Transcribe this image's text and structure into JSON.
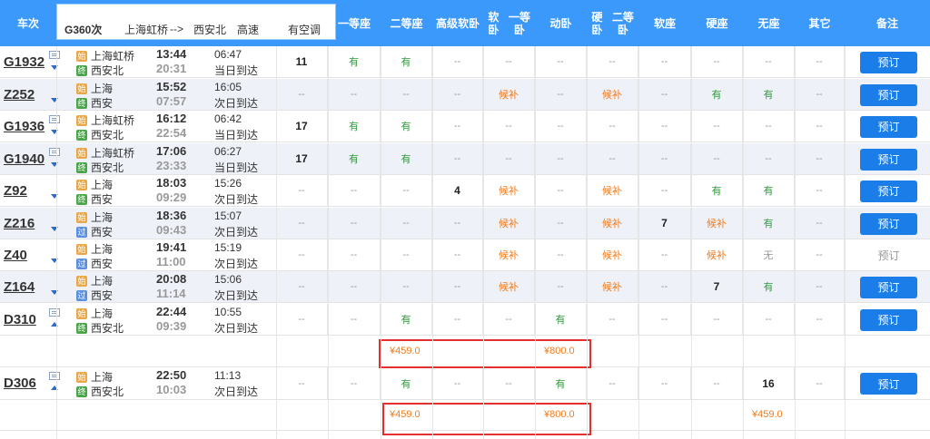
{
  "header": {
    "train_no": "车次",
    "route_train": "G360次",
    "route_from": "上海虹桥",
    "route_arrow": "-->",
    "route_to": "西安北",
    "route_type": "高速",
    "route_status": "有空调",
    "cols": [
      {
        "l1": "一等座",
        "l2": ""
      },
      {
        "l1": "二等座",
        "l2": ""
      },
      {
        "l1": "高级",
        "l2": "软卧"
      },
      {
        "l1": "软卧",
        "l2": "一等卧"
      },
      {
        "l1": "动卧",
        "l2": ""
      },
      {
        "l1": "硬卧",
        "l2": "二等卧"
      },
      {
        "l1": "软座",
        "l2": ""
      },
      {
        "l1": "硬座",
        "l2": ""
      },
      {
        "l1": "无座",
        "l2": ""
      },
      {
        "l1": "其它",
        "l2": ""
      },
      {
        "l1": "备注",
        "l2": ""
      }
    ]
  },
  "badges": {
    "start": "始",
    "end": "终",
    "pass": "过"
  },
  "trains": [
    {
      "no": "G1932",
      "from": "上海虹桥",
      "to": "西安北",
      "from_badge": "始",
      "to_badge": "终",
      "dep": "13:44",
      "arr": "20:31",
      "dur": "06:47",
      "day": "当日到达",
      "cells": [
        "11",
        "有",
        "有",
        "--",
        "--",
        "--",
        "--",
        "--",
        "--",
        "--",
        "--"
      ],
      "book": "预订",
      "book_enabled": true,
      "arrow": "down",
      "card": true
    },
    {
      "no": "Z252",
      "from": "上海",
      "to": "西安",
      "from_badge": "始",
      "to_badge": "终",
      "dep": "15:52",
      "arr": "07:57",
      "dur": "16:05",
      "day": "次日到达",
      "cells": [
        "--",
        "--",
        "--",
        "--",
        "候补",
        "--",
        "候补",
        "--",
        "有",
        "有",
        "--"
      ],
      "book": "预订",
      "book_enabled": true,
      "arrow": "down",
      "card": false
    },
    {
      "no": "G1936",
      "from": "上海虹桥",
      "to": "西安北",
      "from_badge": "始",
      "to_badge": "终",
      "dep": "16:12",
      "arr": "22:54",
      "dur": "06:42",
      "day": "当日到达",
      "cells": [
        "17",
        "有",
        "有",
        "--",
        "--",
        "--",
        "--",
        "--",
        "--",
        "--",
        "--"
      ],
      "book": "预订",
      "book_enabled": true,
      "arrow": "down",
      "card": true
    },
    {
      "no": "G1940",
      "from": "上海虹桥",
      "to": "西安北",
      "from_badge": "始",
      "to_badge": "终",
      "dep": "17:06",
      "arr": "23:33",
      "dur": "06:27",
      "day": "当日到达",
      "cells": [
        "17",
        "有",
        "有",
        "--",
        "--",
        "--",
        "--",
        "--",
        "--",
        "--",
        "--"
      ],
      "book": "预订",
      "book_enabled": true,
      "arrow": "down",
      "card": true
    },
    {
      "no": "Z92",
      "from": "上海",
      "to": "西安",
      "from_badge": "始",
      "to_badge": "终",
      "dep": "18:03",
      "arr": "09:29",
      "dur": "15:26",
      "day": "次日到达",
      "cells": [
        "--",
        "--",
        "--",
        "4",
        "候补",
        "--",
        "候补",
        "--",
        "有",
        "有",
        "--"
      ],
      "book": "预订",
      "book_enabled": true,
      "arrow": "down",
      "card": false
    },
    {
      "no": "Z216",
      "from": "上海",
      "to": "西安",
      "from_badge": "始",
      "to_badge": "过",
      "dep": "18:36",
      "arr": "09:43",
      "dur": "15:07",
      "day": "次日到达",
      "cells": [
        "--",
        "--",
        "--",
        "--",
        "候补",
        "--",
        "候补",
        "7",
        "候补",
        "有",
        "--"
      ],
      "book": "预订",
      "book_enabled": true,
      "arrow": "down",
      "card": false
    },
    {
      "no": "Z40",
      "from": "上海",
      "to": "西安",
      "from_badge": "始",
      "to_badge": "过",
      "dep": "19:41",
      "arr": "11:00",
      "dur": "15:19",
      "day": "次日到达",
      "cells": [
        "--",
        "--",
        "--",
        "--",
        "候补",
        "--",
        "候补",
        "--",
        "候补",
        "无",
        "--"
      ],
      "book": "预订",
      "book_enabled": false,
      "arrow": "down",
      "card": false
    },
    {
      "no": "Z164",
      "from": "上海",
      "to": "西安",
      "from_badge": "始",
      "to_badge": "过",
      "dep": "20:08",
      "arr": "11:14",
      "dur": "15:06",
      "day": "次日到达",
      "cells": [
        "--",
        "--",
        "--",
        "--",
        "候补",
        "--",
        "候补",
        "--",
        "7",
        "有",
        "--"
      ],
      "book": "预订",
      "book_enabled": true,
      "arrow": "down",
      "card": false
    },
    {
      "no": "D310",
      "from": "上海",
      "to": "西安北",
      "from_badge": "始",
      "to_badge": "终",
      "dep": "22:44",
      "arr": "09:39",
      "dur": "10:55",
      "day": "次日到达",
      "cells": [
        "--",
        "--",
        "有",
        "--",
        "--",
        "有",
        "--",
        "--",
        "--",
        "--",
        "--"
      ],
      "book": "预订",
      "book_enabled": true,
      "arrow": "up",
      "card": true
    },
    {
      "no": "D306",
      "from": "上海",
      "to": "西安北",
      "from_badge": "始",
      "to_badge": "终",
      "dep": "22:50",
      "arr": "10:03",
      "dur": "11:13",
      "day": "次日到达",
      "cells": [
        "--",
        "--",
        "有",
        "--",
        "--",
        "有",
        "--",
        "--",
        "--",
        "16",
        "--"
      ],
      "book": "预订",
      "book_enabled": true,
      "arrow": "up",
      "card": true
    }
  ],
  "prices": {
    "d310": {
      "second_class": "¥459.0",
      "sleeper": "¥800.0"
    },
    "d306": {
      "second_class": "¥459.0",
      "sleeper": "¥800.0",
      "no_seat": "¥459.0"
    }
  }
}
